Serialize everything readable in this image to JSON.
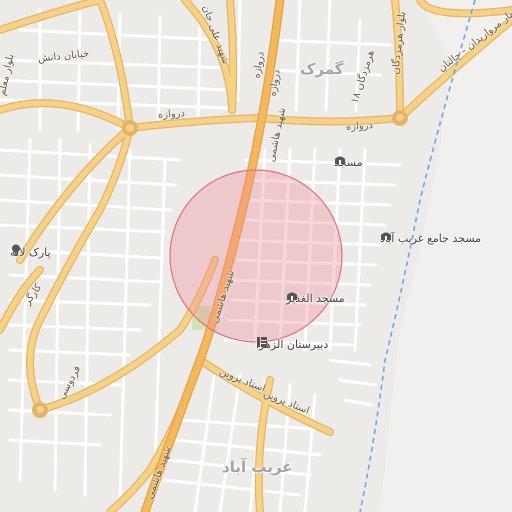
{
  "map": {
    "area_labels": {
      "gomrok": "گمرک",
      "gharib_abad": "غریب آباد"
    },
    "road_labels": {
      "khiaban_danesh": "خیابان دانش",
      "boulevard_moallem": "بلوار معلم",
      "shahid_hashemi_1": "شهید هاشمی",
      "shahid_hashemi_2": "شهید هاشمی",
      "shahid_hashemi_3": "شهید هاشمی",
      "shahid_ali_jani": "شهید علی جان",
      "darvazeh_1": "دروازه",
      "darvazeh_2": "دروازه",
      "darvazeh_3": "دروازه",
      "darvazeh_4": "دروازه",
      "hormozegan_1": "هرمزدگان ۱۸",
      "boulevard_hormozegan": "بلوار هرمزدگان",
      "bahar_merrivan_chaltan": "بهار مرواریدان - چالتان",
      "ferdowsi": "فردوسی",
      "kargar": "کارگر",
      "ostad_parvin_1": "استاد پروین",
      "ostad_parvin_2": "استاد پروین"
    },
    "poi": {
      "masjed": {
        "name": "مسجد",
        "icon": "mosque-icon"
      },
      "masjed_jame": {
        "name": "مسجد جامع غریب آباد",
        "icon": "mosque-icon"
      },
      "masjed_ghadir": {
        "name": "مسجد الغدیر",
        "icon": "mosque-icon"
      },
      "park_laleh": {
        "name": "پارک لاله",
        "icon": "tree-icon"
      },
      "dabirestan_zahra": {
        "name": "دبیرستان الزهرا",
        "icon": "school-icon"
      }
    },
    "colors": {
      "background": "#ecebe8",
      "minor_road": "#ffffff",
      "major_road": "#f7d184",
      "major_road_casing": "#e2b46a",
      "primary_road": "#f4b85c",
      "water": "#6aa5e6",
      "park": "#cfe3b5",
      "search_circle_fill": "#f08a94",
      "search_circle_stroke": "#e0707c"
    }
  }
}
